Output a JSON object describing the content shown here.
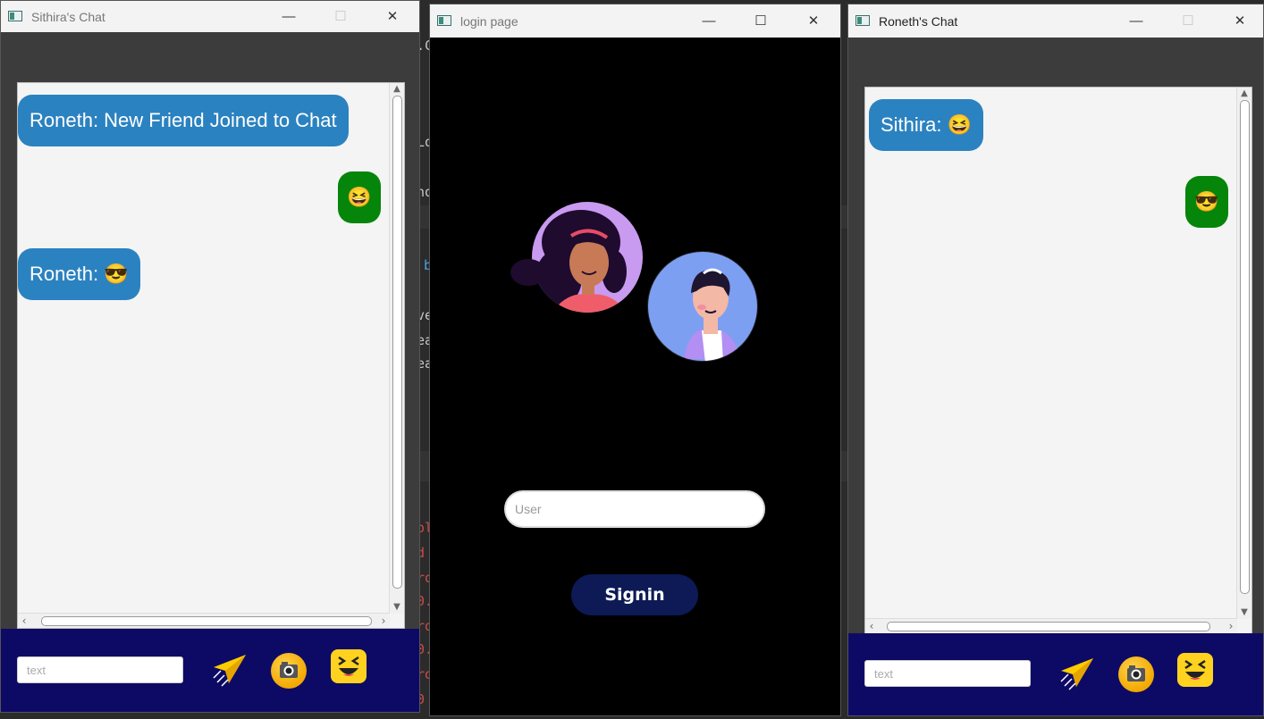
{
  "colors": {
    "incoming_bubble": "#2b82c0",
    "outgoing_bubble": "#05850a",
    "bottom_bar": "#0d0a66",
    "signin_button": "#0d1a56",
    "login_background": "#000000"
  },
  "background_code": {
    "lines": [
      ".C",
      "Lo",
      "no",
      "b",
      "ve",
      "ea",
      "ea"
    ],
    "red_lines": [
      "ol",
      "d",
      "ro",
      "0.",
      "ro",
      "0.",
      "ro",
      "0"
    ]
  },
  "window_controls": {
    "minimize": "—",
    "maximize": "☐",
    "close": "✕"
  },
  "sithira_window": {
    "title": "Sithira's Chat",
    "messages": [
      {
        "direction": "incoming",
        "text": "Roneth: New Friend Joined to Chat"
      },
      {
        "direction": "outgoing",
        "text": "😆"
      },
      {
        "direction": "incoming",
        "text": "Roneth: 😎"
      }
    ],
    "input_placeholder": "text",
    "icons": {
      "send": "paper-plane-icon",
      "camera": "camera-icon",
      "emoji": "laughing-emoji-icon"
    }
  },
  "login_window": {
    "title": "login page",
    "user_placeholder": "User",
    "signin_label": "Signin"
  },
  "roneth_window": {
    "title": "Roneth's Chat",
    "messages": [
      {
        "direction": "incoming",
        "text": "Sithira: 😆"
      },
      {
        "direction": "outgoing",
        "text": "😎"
      }
    ],
    "input_placeholder": "text",
    "icons": {
      "send": "paper-plane-icon",
      "camera": "camera-icon",
      "emoji": "laughing-emoji-icon"
    }
  }
}
